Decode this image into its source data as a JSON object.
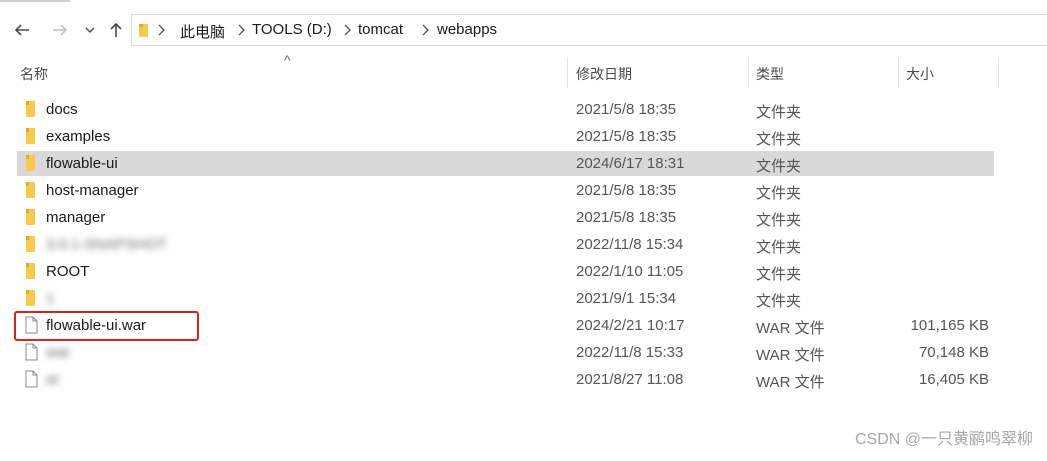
{
  "window": {
    "title": "webapps"
  },
  "nav": {
    "back_icon": "arrow-left-icon",
    "forward_icon": "arrow-right-icon",
    "recent_icon": "chevron-down-icon",
    "up_icon": "arrow-up-icon"
  },
  "breadcrumb": {
    "items": [
      "此电脑",
      "TOOLS (D:)",
      "tomcat",
      "webapps"
    ]
  },
  "columns": {
    "name": "名称",
    "date": "修改日期",
    "type": "类型",
    "size": "大小"
  },
  "files": [
    {
      "name": "docs",
      "date": "2021/5/8 18:35",
      "type": "文件夹",
      "size": "",
      "kind": "folder"
    },
    {
      "name": "examples",
      "date": "2021/5/8 18:35",
      "type": "文件夹",
      "size": "",
      "kind": "folder"
    },
    {
      "name": "flowable-ui",
      "date": "2024/6/17 18:31",
      "type": "文件夹",
      "size": "",
      "kind": "folder",
      "selected": true
    },
    {
      "name": "host-manager",
      "date": "2021/5/8 18:35",
      "type": "文件夹",
      "size": "",
      "kind": "folder"
    },
    {
      "name": "manager",
      "date": "2021/5/8 18:35",
      "type": "文件夹",
      "size": "",
      "kind": "folder"
    },
    {
      "name": "                                   3.0.1-SNAPSHOT",
      "date": "2022/11/8 15:34",
      "type": "文件夹",
      "size": "",
      "kind": "folder",
      "blurred": true
    },
    {
      "name": "ROOT",
      "date": "2022/1/10 11:05",
      "type": "文件夹",
      "size": "",
      "kind": "folder"
    },
    {
      "name": "                    1",
      "date": "2021/9/1 15:34",
      "type": "文件夹",
      "size": "",
      "kind": "folder",
      "blurred": true
    },
    {
      "name": "flowable-ui.war",
      "date": "2024/2/21 10:17",
      "type": "WAR 文件",
      "size": "101,165 KB",
      "kind": "file",
      "highlighted": true
    },
    {
      "name": "                                                war",
      "date": "2022/11/8 15:33",
      "type": "WAR 文件",
      "size": "70,148 KB",
      "kind": "file",
      "blurred": true
    },
    {
      "name": "                    ar",
      "date": "2021/8/27 11:08",
      "type": "WAR 文件",
      "size": "16,405 KB",
      "kind": "file",
      "blurred": true
    }
  ],
  "watermark": "CSDN @一只黄鹂鸣翠柳",
  "colors": {
    "folder": "#f8c94a",
    "selection": "#d9d9d9",
    "highlight_box": "#e0201b"
  }
}
